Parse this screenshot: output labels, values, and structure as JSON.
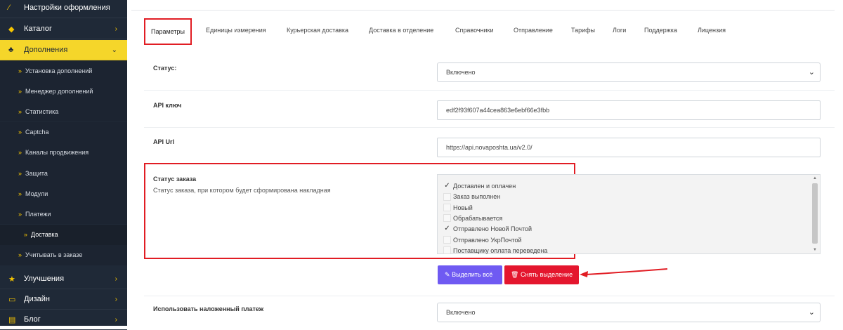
{
  "sidebar": {
    "items_top": [
      {
        "label": "Настройки оформления",
        "icon": "magic-wand-icon",
        "glyph": "⁄"
      },
      {
        "label": "Каталог",
        "icon": "tag-icon",
        "glyph": "◆"
      },
      {
        "label": "Дополнения",
        "icon": "puzzle-icon",
        "glyph": "♣"
      }
    ],
    "sub_items": [
      "Установка дополнений",
      "Менеджер дополнений",
      "Статистика",
      "Captcha",
      "Каналы продвижения",
      "Защита",
      "Модули",
      "Платежи",
      "Доставка",
      "Учитывать в заказе"
    ],
    "items_bottom": [
      {
        "label": "Улучшения",
        "icon": "star-icon",
        "glyph": "★"
      },
      {
        "label": "Дизайн",
        "icon": "monitor-icon",
        "glyph": "▭"
      },
      {
        "label": "Блог",
        "icon": "document-icon",
        "glyph": "▤"
      }
    ],
    "chevron_right": "›",
    "chevron_down": "⌄",
    "bullet": "»"
  },
  "tabs": [
    "Параметры",
    "Единицы измерения",
    "Курьерская доставка",
    "Доставка в отделение",
    "Справочники",
    "Отправление",
    "Тарифы",
    "Логи",
    "Поддержка",
    "Лицензия"
  ],
  "form": {
    "status_label": "Статус:",
    "status_value": "Включено",
    "api_key_label": "API ключ",
    "api_key_value": "edf2f93f607a44cea863e6ebf66e3fbb",
    "api_url_label": "API Url",
    "api_url_value": "https://api.novaposhta.ua/v2.0/",
    "order_status_title": "Статус заказа",
    "order_status_desc": "Статус заказа, при котором будет сформирована накладная",
    "order_statuses": [
      {
        "label": "Доставлен и оплачен",
        "checked": true
      },
      {
        "label": "Заказ выполнен",
        "checked": false
      },
      {
        "label": "Новый",
        "checked": false
      },
      {
        "label": "Обрабатывается",
        "checked": false
      },
      {
        "label": "Отправлено Новой Почтой",
        "checked": true
      },
      {
        "label": "Отправлено УкрПочтой",
        "checked": false
      },
      {
        "label": "Поставщику оплата переведена",
        "checked": false
      }
    ],
    "select_all_label": "Выделить всё",
    "deselect_label": "Снять выделение",
    "cod_label": "Использовать наложенный платеж",
    "cod_value": "Включено"
  },
  "colors": {
    "sidebar_bg": "#1f2937",
    "active_menu": "#f5d62a",
    "highlight_red": "#e11d24",
    "select_all_btn": "#6f5af2",
    "deselect_btn": "#e4162e"
  }
}
